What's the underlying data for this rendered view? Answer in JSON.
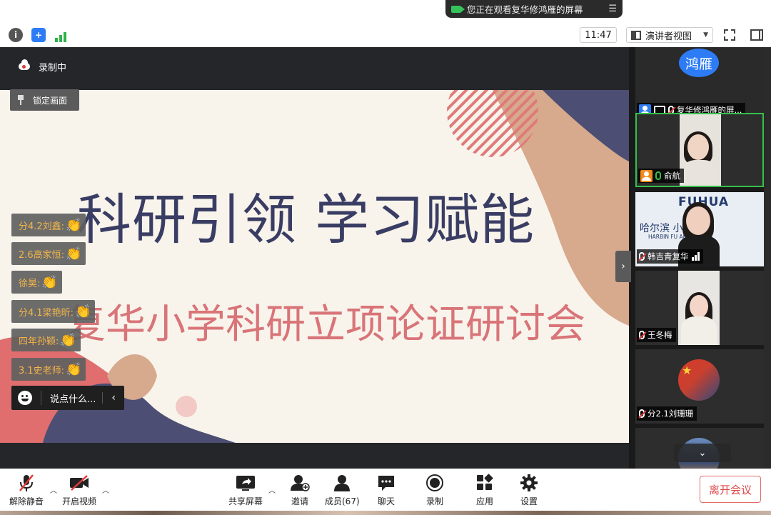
{
  "banner": {
    "text": "您正在观看复华修鸿雁的屏幕"
  },
  "topbar": {
    "time": "11:47",
    "view_label": "演讲者视图"
  },
  "recording": {
    "label": "录制中"
  },
  "lock_button": {
    "label": "锁定画面"
  },
  "slide": {
    "title": "科研引领  学习赋能",
    "subtitle": "复华小学科研立项论证研讨会"
  },
  "reactions": [
    {
      "label": "分4.2刘鑫:",
      "emoji": "👏"
    },
    {
      "label": "2.6高家恒:",
      "emoji": "👏"
    },
    {
      "label": "徐昊:",
      "emoji": "👏"
    },
    {
      "label": "分4.1梁艳昕:",
      "emoji": "👏"
    },
    {
      "label": "四年孙颖:",
      "emoji": "👏"
    },
    {
      "label": "3.1史老师:",
      "emoji": "👏"
    }
  ],
  "chat_box": {
    "placeholder": "说点什么..."
  },
  "gallery": [
    {
      "avatar_text": "鸿雁",
      "name": "复华修鸿雁的屏..."
    },
    {
      "name": "俞航"
    },
    {
      "name": "韩吉青复华",
      "logo": "FUHUA",
      "school_cn": "哈尔滨    小学校",
      "school_en": "HARBIN FU       ARY SCHOOL"
    },
    {
      "name": "王冬梅"
    },
    {
      "name": "分2.1刘珊珊"
    }
  ],
  "toolbar": {
    "unmute": "解除静音",
    "start_video": "开启视频",
    "share_screen": "共享屏幕",
    "invite": "邀请",
    "members": "成员(67)",
    "chat": "聊天",
    "record": "录制",
    "apps": "应用",
    "settings": "设置",
    "leave": "离开会议"
  },
  "colors": {
    "accent_blue": "#2d7cf6",
    "active_green": "#35c04a",
    "title_navy": "#3a3d63",
    "subtitle_pink": "#d97478",
    "leave_red": "#e04646"
  }
}
